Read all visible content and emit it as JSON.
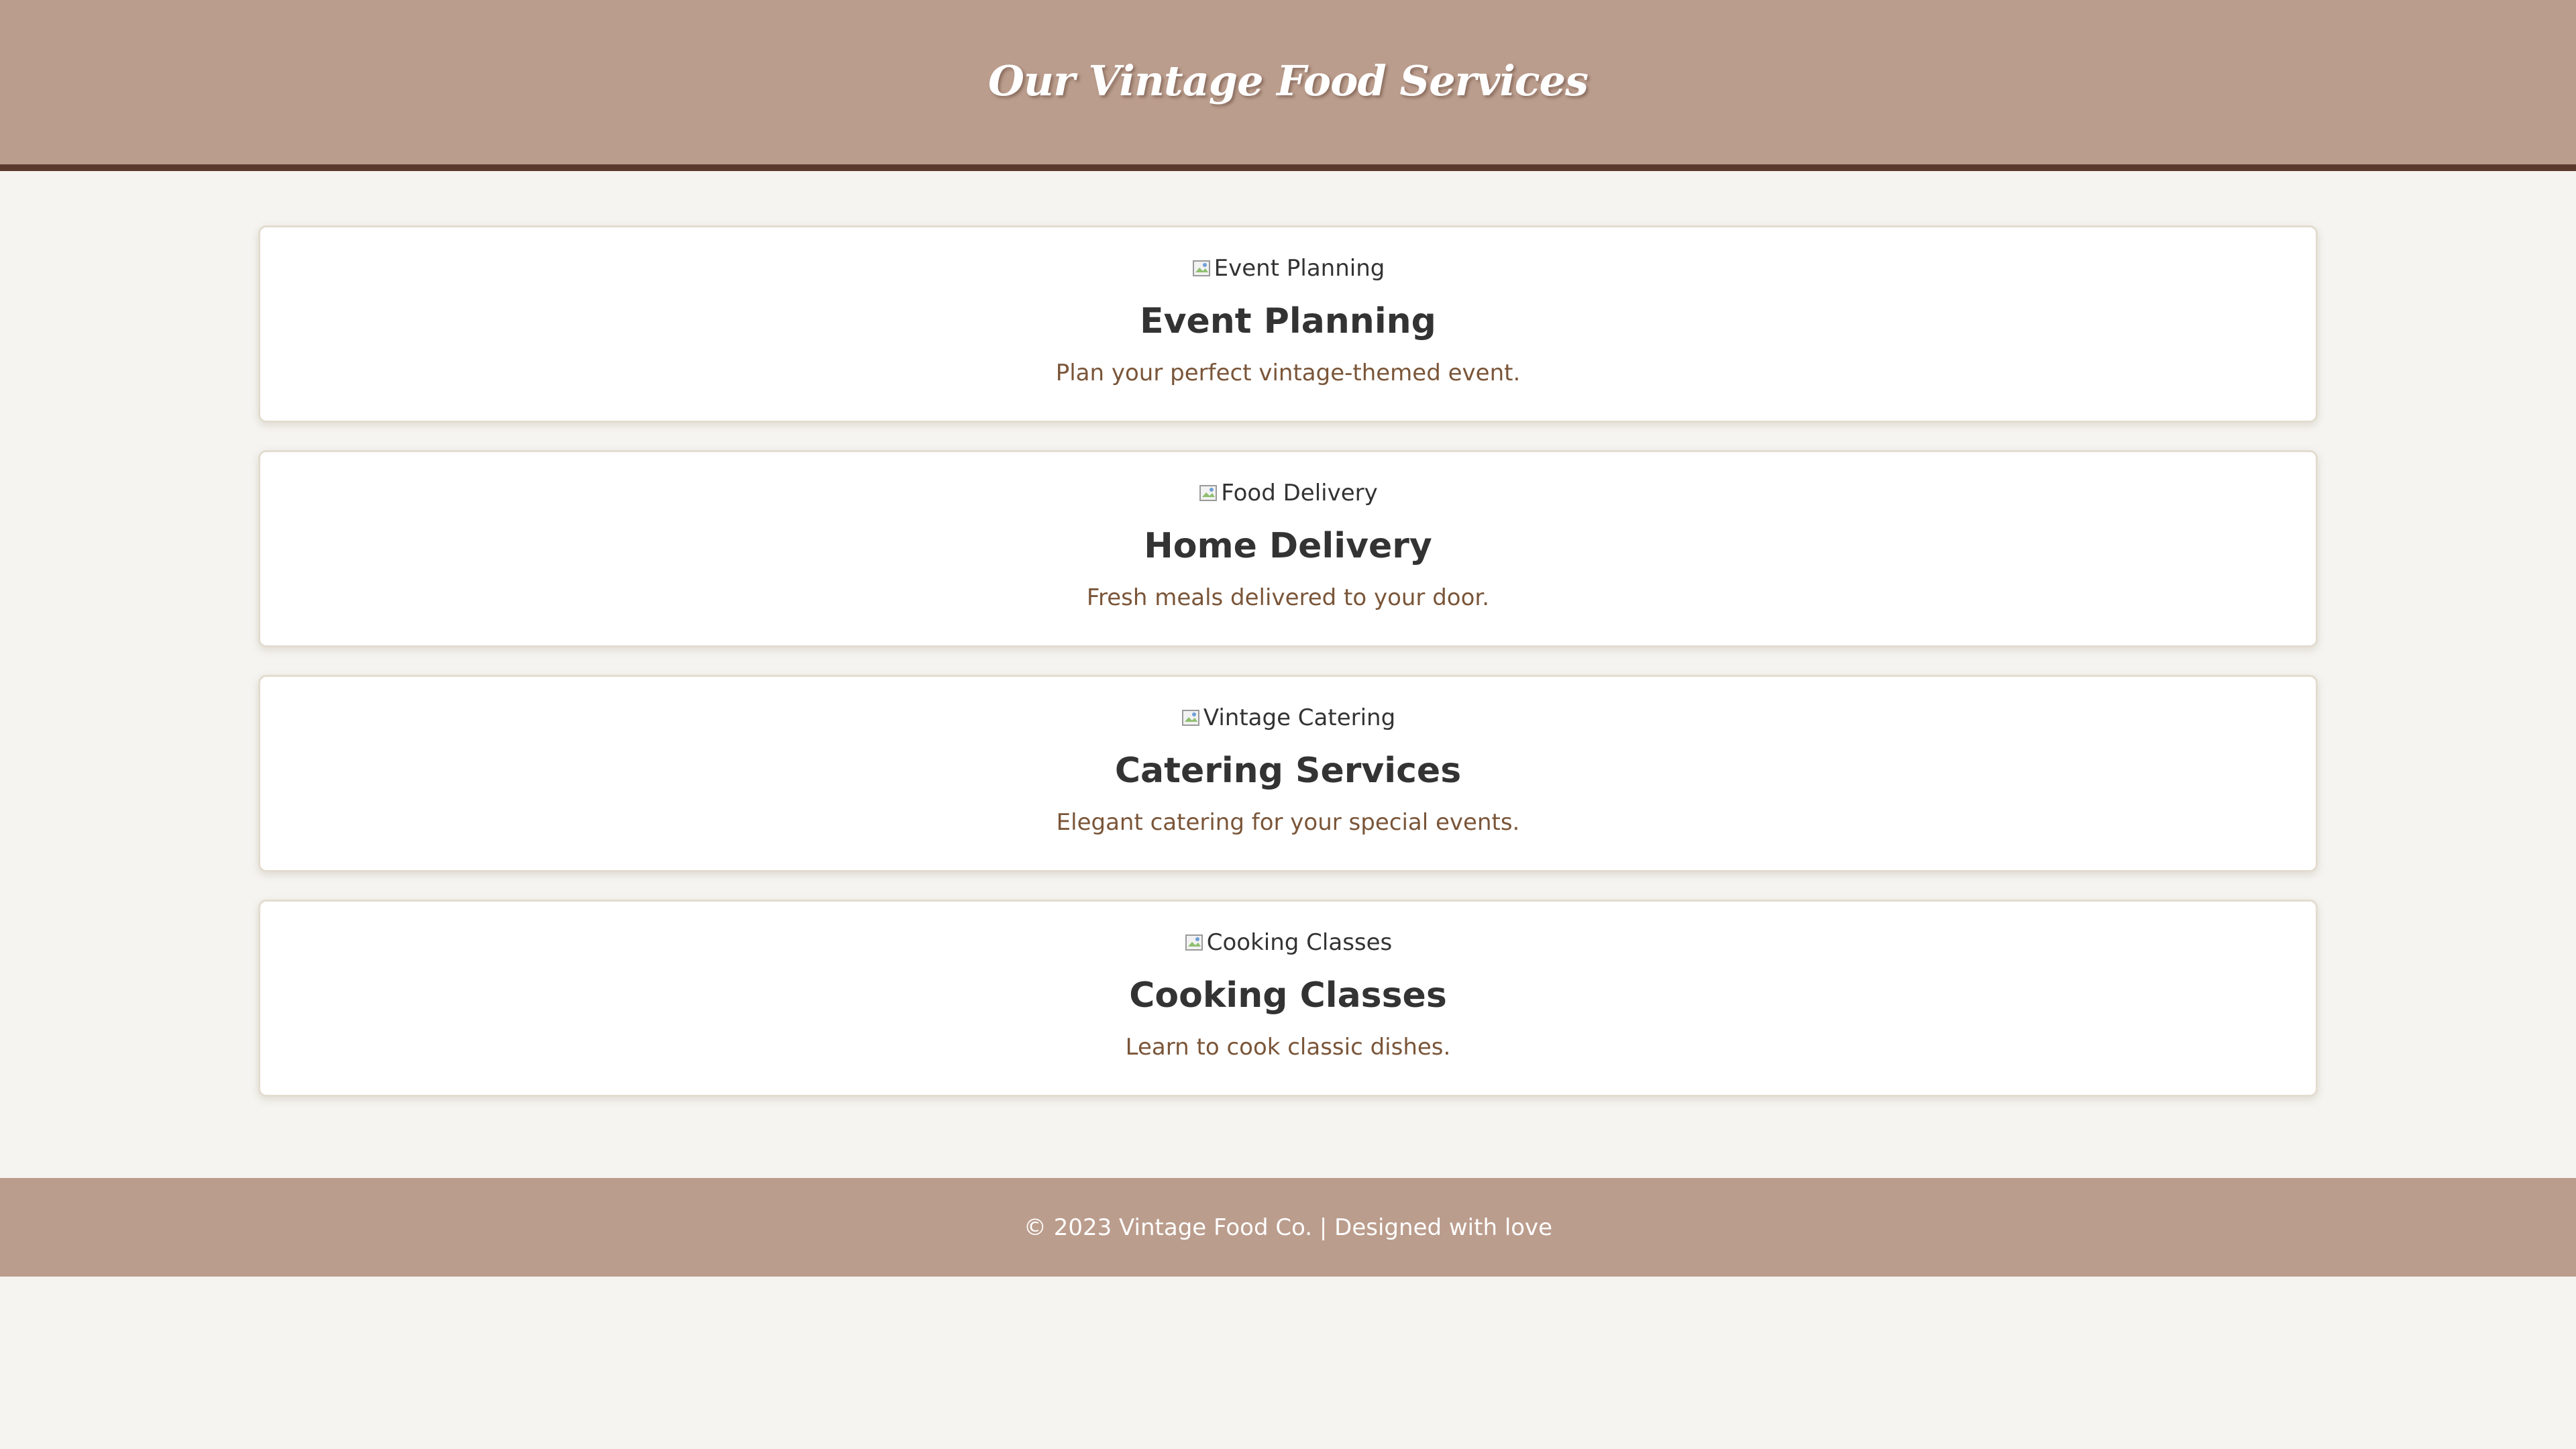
{
  "header": {
    "title": "Our Vintage Food Services"
  },
  "services": [
    {
      "image_alt": "Event Planning",
      "title": "Event Planning",
      "description": "Plan your perfect vintage-themed event."
    },
    {
      "image_alt": "Food Delivery",
      "title": "Home Delivery",
      "description": "Fresh meals delivered to your door."
    },
    {
      "image_alt": "Vintage Catering",
      "title": "Catering Services",
      "description": "Elegant catering for your special events."
    },
    {
      "image_alt": "Cooking Classes",
      "title": "Cooking Classes",
      "description": "Learn to cook classic dishes."
    }
  ],
  "footer": {
    "text": "© 2023 Vintage Food Co. | Designed with love"
  },
  "colors": {
    "header_bg": "#bb9d8d",
    "header_border": "#5b3a2e",
    "page_bg": "#f5f4f0",
    "description_text": "#7a5538"
  },
  "icons": {
    "broken_image": "broken-image-icon"
  }
}
